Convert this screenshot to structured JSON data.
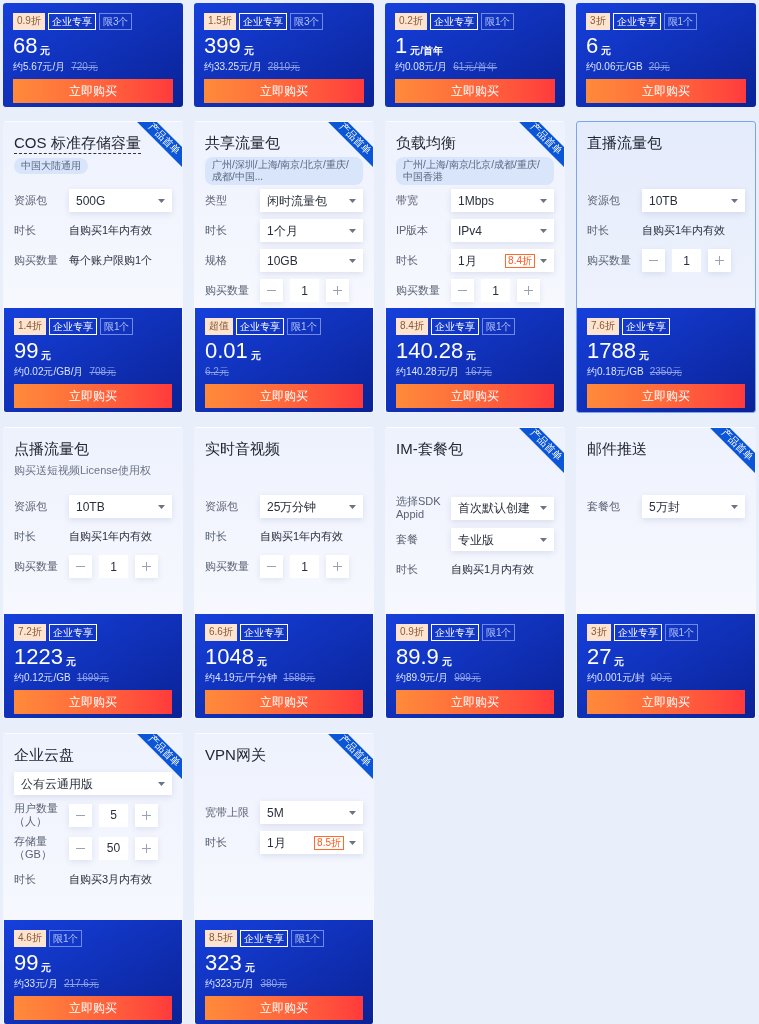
{
  "cards": [
    {
      "badges": [
        {
          "kind": "discount",
          "text": "0.9折"
        },
        {
          "kind": "enterprise",
          "text": "企业专享"
        },
        {
          "kind": "limit",
          "text": "限3个"
        }
      ],
      "price": "68",
      "unit": "元",
      "per_unit": "约5.67元/月",
      "original_price": "720元",
      "button": "立即购买"
    },
    {
      "badges": [
        {
          "kind": "discount",
          "text": "1.5折"
        },
        {
          "kind": "enterprise",
          "text": "企业专享"
        },
        {
          "kind": "limit",
          "text": "限3个"
        }
      ],
      "price": "399",
      "unit": "元",
      "per_unit": "约33.25元/月",
      "original_price": "2810元",
      "button": "立即购买"
    },
    {
      "badges": [
        {
          "kind": "discount",
          "text": "0.2折"
        },
        {
          "kind": "enterprise",
          "text": "企业专享"
        },
        {
          "kind": "limit",
          "text": "限1个"
        }
      ],
      "price": "1",
      "unit": "元/首年",
      "per_unit": "约0.08元/月",
      "original_price": "61元/首年",
      "button": "立即购买"
    },
    {
      "badges": [
        {
          "kind": "discount",
          "text": "3折"
        },
        {
          "kind": "enterprise",
          "text": "企业专享"
        },
        {
          "kind": "limit",
          "text": "限1个"
        }
      ],
      "price": "6",
      "unit": "元",
      "per_unit": "约0.06元/GB",
      "original_price": "20元",
      "button": "立即购买"
    },
    {
      "title": "COS 标准存储容量",
      "title_underlined": true,
      "tag": "中国大陆通用",
      "ribbon": "产品首单",
      "selected": false,
      "fields": [
        {
          "kind": "select",
          "label": "资源包",
          "value": "500G"
        },
        {
          "kind": "text",
          "label": "时长",
          "value": "自购买1年内有效"
        },
        {
          "kind": "text",
          "label": "购买数量",
          "value": "每个账户限购1个"
        }
      ],
      "badges": [
        {
          "kind": "discount",
          "text": "1.4折"
        },
        {
          "kind": "enterprise",
          "text": "企业专享"
        },
        {
          "kind": "limit",
          "text": "限1个"
        }
      ],
      "price": "99",
      "unit": "元",
      "per_unit": "约0.02元/GB/月",
      "original_price": "708元",
      "button": "立即购买"
    },
    {
      "title": "共享流量包",
      "tag": "广州/深圳/上海/南京/北京/重庆/成都/中国...",
      "ribbon": "产品首单",
      "selected": false,
      "fields": [
        {
          "kind": "select",
          "label": "类型",
          "value": "闲时流量包"
        },
        {
          "kind": "select",
          "label": "时长",
          "value": "1个月"
        },
        {
          "kind": "select",
          "label": "规格",
          "value": "10GB"
        },
        {
          "kind": "stepper",
          "label": "购买数量",
          "value": "1"
        }
      ],
      "badges": [
        {
          "kind": "discount",
          "text": "超值"
        },
        {
          "kind": "enterprise",
          "text": "企业专享"
        },
        {
          "kind": "limit",
          "text": "限1个"
        }
      ],
      "price": "0.01",
      "unit": "元",
      "original_price": "6.2元",
      "button": "立即购买"
    },
    {
      "title": "负载均衡",
      "tag": "广州/上海/南京/北京/成都/重庆/中国香港",
      "ribbon": "产品首单",
      "selected": false,
      "fields": [
        {
          "kind": "select",
          "label": "带宽",
          "value": "1Mbps"
        },
        {
          "kind": "select",
          "label": "IP版本",
          "value": "IPv4"
        },
        {
          "kind": "select",
          "label": "时长",
          "value": "1月",
          "discount": "8.4折"
        },
        {
          "kind": "stepper",
          "label": "购买数量",
          "value": "1"
        }
      ],
      "badges": [
        {
          "kind": "discount",
          "text": "8.4折"
        },
        {
          "kind": "enterprise",
          "text": "企业专享"
        },
        {
          "kind": "limit",
          "text": "限1个"
        }
      ],
      "price": "140.28",
      "unit": "元",
      "per_unit": "约140.28元/月",
      "original_price": "167元",
      "button": "立即购买"
    },
    {
      "title": "直播流量包",
      "selected": true,
      "fields": [
        {
          "kind": "select",
          "label": "资源包",
          "value": "10TB"
        },
        {
          "kind": "text",
          "label": "时长",
          "value": "自购买1年内有效"
        },
        {
          "kind": "stepper",
          "label": "购买数量",
          "value": "1"
        }
      ],
      "badges": [
        {
          "kind": "discount",
          "text": "7.6折"
        },
        {
          "kind": "enterprise",
          "text": "企业专享"
        }
      ],
      "price": "1788",
      "unit": "元",
      "per_unit": "约0.18元/GB",
      "original_price": "2350元",
      "button": "立即购买"
    },
    {
      "title": "点播流量包",
      "subtitle": "购买送短视频License使用权",
      "selected": false,
      "fields": [
        {
          "kind": "select",
          "label": "资源包",
          "value": "10TB"
        },
        {
          "kind": "text",
          "label": "时长",
          "value": "自购买1年内有效"
        },
        {
          "kind": "stepper",
          "label": "购买数量",
          "value": "1"
        }
      ],
      "badges": [
        {
          "kind": "discount",
          "text": "7.2折"
        },
        {
          "kind": "enterprise",
          "text": "企业专享"
        }
      ],
      "price": "1223",
      "unit": "元",
      "per_unit": "约0.12元/GB",
      "original_price": "1699元",
      "button": "立即购买"
    },
    {
      "title": "实时音视频",
      "selected": false,
      "fields": [
        {
          "kind": "select",
          "label": "资源包",
          "value": "25万分钟"
        },
        {
          "kind": "text",
          "label": "时长",
          "value": "自购买1年内有效"
        },
        {
          "kind": "stepper",
          "label": "购买数量",
          "value": "1"
        }
      ],
      "badges": [
        {
          "kind": "discount",
          "text": "6.6折"
        },
        {
          "kind": "enterprise",
          "text": "企业专享"
        }
      ],
      "price": "1048",
      "unit": "元",
      "per_unit": "约4.19元/千分钟",
      "original_price": "1588元",
      "button": "立即购买"
    },
    {
      "title": "IM-套餐包",
      "ribbon": "产品首单",
      "selected": false,
      "fields": [
        {
          "kind": "select",
          "label": "选择SDK Appid",
          "value": "首次默认创建"
        },
        {
          "kind": "select",
          "label": "套餐",
          "value": "专业版"
        },
        {
          "kind": "text",
          "label": "时长",
          "value": "自购买1月内有效"
        }
      ],
      "badges": [
        {
          "kind": "discount",
          "text": "0.9折"
        },
        {
          "kind": "enterprise",
          "text": "企业专享"
        },
        {
          "kind": "limit",
          "text": "限1个"
        }
      ],
      "price": "89.9",
      "unit": "元",
      "per_unit": "约89.9元/月",
      "original_price": "999元",
      "button": "立即购买"
    },
    {
      "title": "邮件推送",
      "ribbon": "产品首单",
      "selected": false,
      "fields": [
        {
          "kind": "select",
          "label": "套餐包",
          "value": "5万封"
        }
      ],
      "badges": [
        {
          "kind": "discount",
          "text": "3折"
        },
        {
          "kind": "enterprise",
          "text": "企业专享"
        },
        {
          "kind": "limit",
          "text": "限1个"
        }
      ],
      "price": "27",
      "unit": "元",
      "per_unit": "约0.001元/封",
      "original_price": "90元",
      "button": "立即购买"
    },
    {
      "title": "企业云盘",
      "ribbon": "产品首单",
      "selected": false,
      "fields": [
        {
          "kind": "select",
          "value": "公有云通用版"
        },
        {
          "kind": "stepper",
          "label": "用户数量（人）",
          "value": "5"
        },
        {
          "kind": "stepper",
          "label": "存储量（GB）",
          "value": "50"
        },
        {
          "kind": "text",
          "label": "时长",
          "value": "自购买3月内有效"
        }
      ],
      "badges": [
        {
          "kind": "discount",
          "text": "4.6折"
        },
        {
          "kind": "limit",
          "text": "限1个"
        }
      ],
      "price": "99",
      "unit": "元",
      "per_unit": "约33元/月",
      "original_price": "217.6元",
      "button": "立即购买"
    },
    {
      "title": "VPN网关",
      "ribbon": "产品首单",
      "selected": false,
      "fields": [
        {
          "kind": "select",
          "label": "宽带上限",
          "value": "5M"
        },
        {
          "kind": "select",
          "label": "时长",
          "value": "1月",
          "discount": "8.5折"
        }
      ],
      "badges": [
        {
          "kind": "discount",
          "text": "8.5折"
        },
        {
          "kind": "enterprise",
          "text": "企业专享"
        },
        {
          "kind": "limit",
          "text": "限1个"
        }
      ],
      "price": "323",
      "unit": "元",
      "per_unit": "约323元/月",
      "original_price": "380元",
      "button": "立即购买"
    }
  ]
}
